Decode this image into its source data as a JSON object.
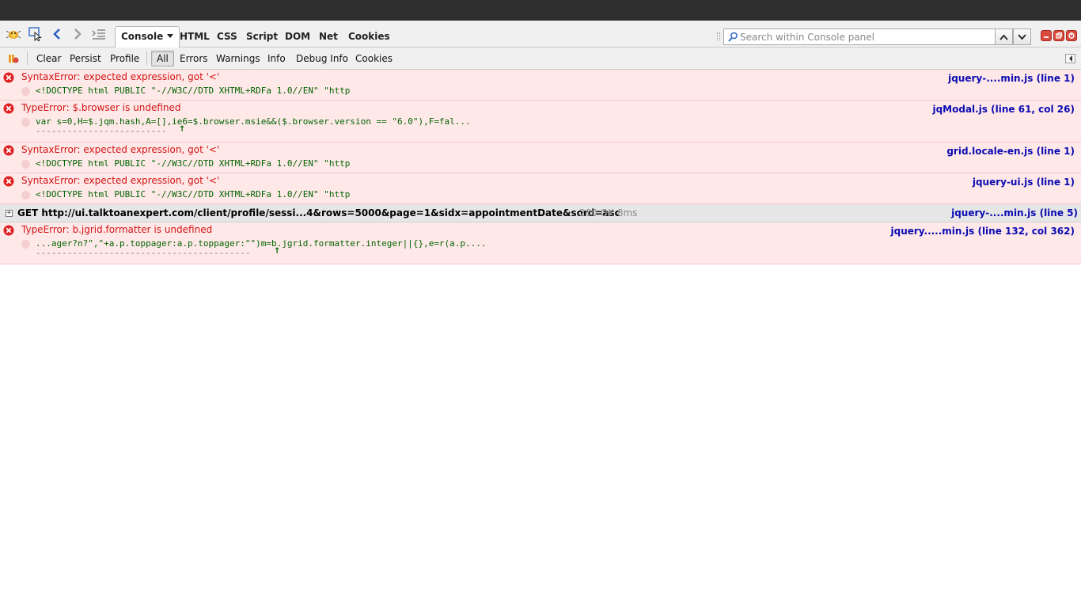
{
  "toolbar": {
    "tabs": [
      {
        "label": "Console"
      },
      {
        "label": "HTML"
      },
      {
        "label": "CSS"
      },
      {
        "label": "Script"
      },
      {
        "label": "DOM"
      },
      {
        "label": "Net"
      },
      {
        "label": "Cookies"
      }
    ],
    "search_placeholder": "Search within Console panel"
  },
  "console_toolbar": {
    "clear": "Clear",
    "persist": "Persist",
    "profile": "Profile",
    "filters": [
      "All",
      "Errors",
      "Warnings",
      "Info",
      "Debug Info",
      "Cookies"
    ],
    "active_filter": "All"
  },
  "log": [
    {
      "type": "error",
      "message": "SyntaxError: expected expression, got '<'",
      "source": "jquery-....min.js (line 1)",
      "code": "<!DOCTYPE html PUBLIC \"-//W3C//DTD XHTML+RDFa 1.0//EN\" \"http"
    },
    {
      "type": "error",
      "message": "TypeError: $.browser is undefined",
      "source": "jqModal.js (line 61, col 26)",
      "code": "var s=0,H=$.jqm.hash,A=[],ie6=$.browser.msie&&($.browser.version == \"6.0\"),F=fal...",
      "dashes": "-------------------------"
    },
    {
      "type": "error",
      "message": "SyntaxError: expected expression, got '<'",
      "source": "grid.locale-en.js (line 1)",
      "code": "<!DOCTYPE html PUBLIC \"-//W3C//DTD XHTML+RDFa 1.0//EN\" \"http"
    },
    {
      "type": "error",
      "message": "SyntaxError: expected expression, got '<'",
      "source": "jquery-ui.js (line 1)",
      "code": "<!DOCTYPE html PUBLIC \"-//W3C//DTD XHTML+RDFa 1.0//EN\" \"http"
    },
    {
      "type": "net",
      "message": "GET http://ui.talktoanexpert.com/client/profile/sessi...4&rows=5000&page=1&sidx=appointmentDate&sord=asc",
      "status": "200 OK 8ms",
      "source": "jquery-....min.js (line 5)"
    },
    {
      "type": "error",
      "message": "TypeError: b.jgrid.formatter is undefined",
      "source": "jquery.....min.js (line 132, col 362)",
      "code": "...ager?n?\",\"+a.p.toppager:a.p.toppager:\"\")m=b.jgrid.formatter.integer||{},e=r(a.p....",
      "dashes": "-----------------------------------------"
    }
  ],
  "colors": {
    "error_bg": "#ffe8e8",
    "error_text": "#d21414",
    "source_link": "#0b0bb3",
    "code_text": "#006400"
  }
}
